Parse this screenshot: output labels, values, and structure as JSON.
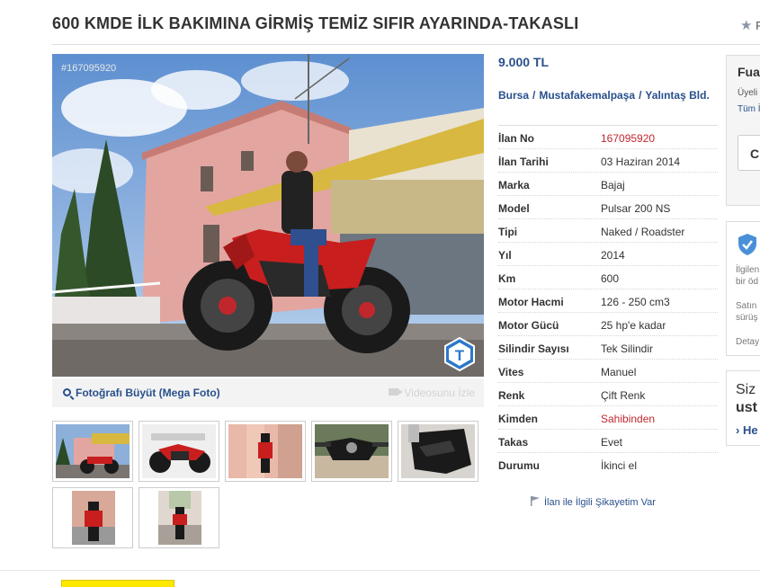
{
  "listing": {
    "title": "600 KMDE İLK BAKIMINA GİRMİŞ TEMİZ SIFIR AYARINDA-TAKASLI",
    "favorite_label": "F",
    "photo_id": "#167095920",
    "enlarge_label": "Fotoğrafı Büyüt (Mega Foto)",
    "video_label": "Videosunu İzle",
    "badge_letter": "T",
    "price": "9.000 TL",
    "location": {
      "city": "Bursa",
      "district": "Mustafakemalpaşa",
      "neighborhood": "Yalıntaş Bld.",
      "separator": "/"
    },
    "details": [
      {
        "key": "İlan No",
        "value": "167095920",
        "highlight": true
      },
      {
        "key": "İlan Tarihi",
        "value": "03 Haziran 2014",
        "highlight": false
      },
      {
        "key": "Marka",
        "value": "Bajaj",
        "highlight": false
      },
      {
        "key": "Model",
        "value": "Pulsar 200 NS",
        "highlight": false
      },
      {
        "key": "Tipi",
        "value": "Naked / Roadster",
        "highlight": false
      },
      {
        "key": "Yıl",
        "value": "2014",
        "highlight": false
      },
      {
        "key": "Km",
        "value": "600",
        "highlight": false
      },
      {
        "key": "Motor Hacmi",
        "value": "126 - 250 cm3",
        "highlight": false
      },
      {
        "key": "Motor Gücü",
        "value": "25 hp'e kadar",
        "highlight": false
      },
      {
        "key": "Silindir Sayısı",
        "value": "Tek Silindir",
        "highlight": false
      },
      {
        "key": "Vites",
        "value": "Manuel",
        "highlight": false
      },
      {
        "key": "Renk",
        "value": "Çift Renk",
        "highlight": false
      },
      {
        "key": "Kimden",
        "value": "Sahibinden",
        "highlight": true
      },
      {
        "key": "Takas",
        "value": "Evet",
        "highlight": false
      },
      {
        "key": "Durumu",
        "value": "İkinci el",
        "highlight": false
      }
    ],
    "complaint_label": "İlan ile İlgili Şikayetim Var"
  },
  "sidebar": {
    "box1": {
      "heading": "Fua",
      "line1": "Üyeli",
      "line2": "Tüm İ",
      "button": "C"
    },
    "box2": {
      "line1": "İlgilen",
      "line2": "bir öd",
      "line3": "Satın",
      "line4": "sürüş",
      "line5": "Detay"
    },
    "box3": {
      "line1": "Siz a",
      "line2": "ust",
      "link": "› He"
    }
  },
  "colors": {
    "link": "#28508c",
    "accent_red": "#c0272d",
    "title": "#333333"
  }
}
